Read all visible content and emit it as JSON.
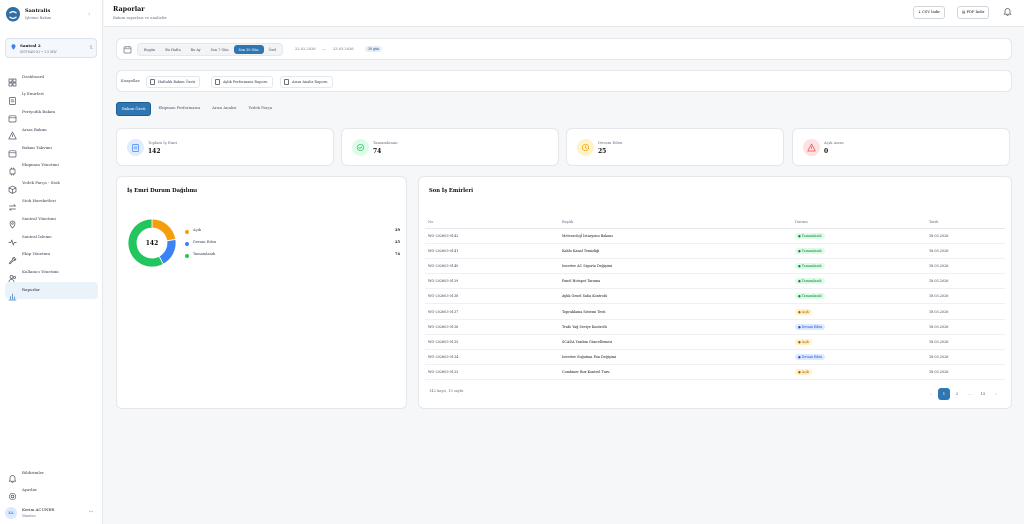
{
  "brand": {
    "name": "Santralis",
    "subtitle": "Işletme Bakım"
  },
  "plant": {
    "name": "Santral 2",
    "meta": "SNT-SAN-02 • 1.5 MW"
  },
  "nav": [
    {
      "label": "Dashboard",
      "icon": "grid-icon"
    },
    {
      "label": "İş Emirleri",
      "icon": "clipboard-icon"
    },
    {
      "label": "Periyodik Bakım",
      "icon": "calendar-icon"
    },
    {
      "label": "Arıza Bakım",
      "icon": "warning-icon"
    },
    {
      "label": "Bakım Takvimi",
      "icon": "calendar-icon"
    },
    {
      "label": "Ekipman Yönetimi",
      "icon": "cpu-icon"
    },
    {
      "label": "Yedek Parça - Stok",
      "icon": "box-icon"
    },
    {
      "label": "Stok Hareketleri",
      "icon": "arrows-icon"
    },
    {
      "label": "Santral Yönetimi",
      "icon": "pin-icon"
    },
    {
      "label": "Santral İzleme",
      "icon": "activity-icon"
    },
    {
      "label": "Ekip Yönetimi",
      "icon": "wrench-icon"
    },
    {
      "label": "Kullanıcı Yönetimi",
      "icon": "users-icon"
    },
    {
      "label": "Raporlar",
      "icon": "bar-chart-icon"
    }
  ],
  "bottom_nav": [
    {
      "label": "Bildirimler",
      "icon": "bell-icon"
    },
    {
      "label": "Ayarlar",
      "icon": "gear-icon"
    }
  ],
  "user": {
    "initials": "KA",
    "name": "Kerim ACUNER",
    "role": "Yönetici"
  },
  "header": {
    "title": "Raporlar",
    "subtitle": "Bakım raporları ve analizler",
    "csv_label": "CSV İndir",
    "pdf_label": "PDF İndir"
  },
  "date_filter": {
    "options": [
      "Bugün",
      "Bu Hafta",
      "Bu Ay",
      "Son 7 Gün",
      "Son 30 Gün",
      "Özel"
    ],
    "active": "Son 30 Gün",
    "start": "22.02.2026",
    "separator": "—",
    "end": "23.03.2026",
    "days": "30 gün"
  },
  "shortcuts": {
    "label": "Kısayollar:",
    "items": [
      "Haftalık Bakım Özeti",
      "Aylık Performans Raporu",
      "Arıza Analiz Raporu"
    ]
  },
  "tabs": [
    "Bakım Özeti",
    "Ekipman Performansı",
    "Arıza Analizi",
    "Yedek Parça"
  ],
  "stats": [
    {
      "label": "Toplam İş Emri",
      "value": "142",
      "color": "#3b82f6",
      "bg": "#e0ecfb",
      "icon": "clipboard-icon"
    },
    {
      "label": "Tamamlanan",
      "value": "74",
      "color": "#22c55e",
      "bg": "#dcfce7",
      "icon": "check-circle-icon"
    },
    {
      "label": "Devam Eden",
      "value": "25",
      "color": "#f59e0b",
      "bg": "#fef3c7",
      "icon": "clock-icon"
    },
    {
      "label": "Açık Arıza",
      "value": "0",
      "color": "#ef4444",
      "bg": "#fee2e2",
      "icon": "warning-icon"
    }
  ],
  "status_chart": {
    "title": "İş Emri Durum Dağılımı",
    "center_label": "142"
  },
  "chart_data": {
    "type": "pie",
    "categories": [
      "Açık",
      "Devam Eden",
      "Tamamlandı"
    ],
    "values": [
      29,
      25,
      74
    ],
    "colors": [
      "#f59e0b",
      "#3b82f6",
      "#22c55e"
    ],
    "title": "İş Emri Durum Dağılımı",
    "legend": "right"
  },
  "recent": {
    "title": "Son İş Emirleri",
    "columns": [
      "No",
      "Başlık",
      "Durum",
      "Tarih"
    ],
    "rows": [
      {
        "no": "WO-202603-0142",
        "title": "Meteorolojİ İstasyonu Bakımı",
        "status": "Tamamlandı",
        "kind": "t",
        "date": "18.03.2026"
      },
      {
        "no": "WO-202603-0141",
        "title": "Kablo Kanal Temizliği",
        "status": "Tamamlandı",
        "kind": "t",
        "date": "18.03.2026"
      },
      {
        "no": "WO-202603-0140",
        "title": "Inverter AC Sigorta Değişimi",
        "status": "Tamamlandı",
        "kind": "t",
        "date": "18.03.2026"
      },
      {
        "no": "WO-202603-0139",
        "title": "Panel Hotspot Tarama",
        "status": "Tamamlandı",
        "kind": "t",
        "date": "18.03.2026"
      },
      {
        "no": "WO-202603-0138",
        "title": "Aylık Genel Saha Kontrolü",
        "status": "Tamamlandı",
        "kind": "t",
        "date": "18.03.2026"
      },
      {
        "no": "WO-202603-0137",
        "title": "Topraklama Sistemi Testi",
        "status": "Açık",
        "kind": "a",
        "date": "18.03.2026"
      },
      {
        "no": "WO-202603-0136",
        "title": "Trafo Yağ Seviye Kontrolü",
        "status": "Devam Eden",
        "kind": "d",
        "date": "18.03.2026"
      },
      {
        "no": "WO-202603-0135",
        "title": "SCADA Yazılım Güncellemesi",
        "status": "Açık",
        "kind": "a",
        "date": "18.03.2026"
      },
      {
        "no": "WO-202603-0134",
        "title": "Inverter Soğutma Fan Değişimi",
        "status": "Devam Eden",
        "kind": "d",
        "date": "18.03.2026"
      },
      {
        "no": "WO-202603-0133",
        "title": "Combiner Box Kontrol Turu",
        "status": "Açık",
        "kind": "a",
        "date": "18.03.2026"
      }
    ],
    "footer": "142 kayıt, 15 sayfa",
    "pages": [
      "‹",
      "1",
      "2",
      "...",
      "15",
      "›"
    ]
  }
}
